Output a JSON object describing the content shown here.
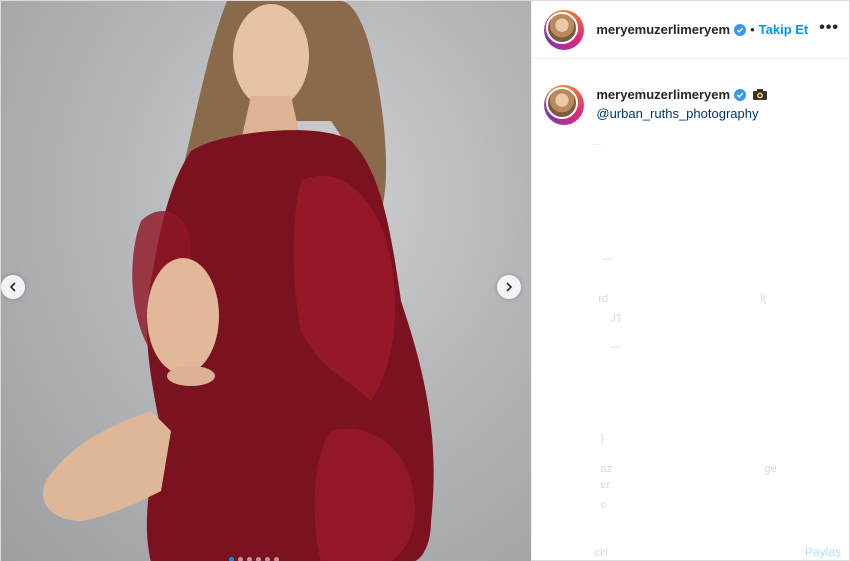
{
  "post": {
    "username": "meryemuzerlimeryem",
    "follow_label": "Takip Et",
    "separator": "•",
    "more_label": "•••"
  },
  "caption": {
    "username": "meryemuzerlimeryem",
    "mention": "@urban_ruths_photography"
  },
  "faded_fragments": [
    "...",
    "—",
    "rd",
    "l(",
    "JT",
    "—",
    "}",
    "az",
    "ge",
    "er",
    "c",
    "ckl"
  ],
  "footer": {
    "share_label": "Paylaş"
  },
  "carousel": {
    "slide_count": 6,
    "active_index": 0
  },
  "colors": {
    "accent": "#0095f6",
    "verified": "#3897f0",
    "dress": "#7b1220",
    "background": "#b6b7ba"
  }
}
